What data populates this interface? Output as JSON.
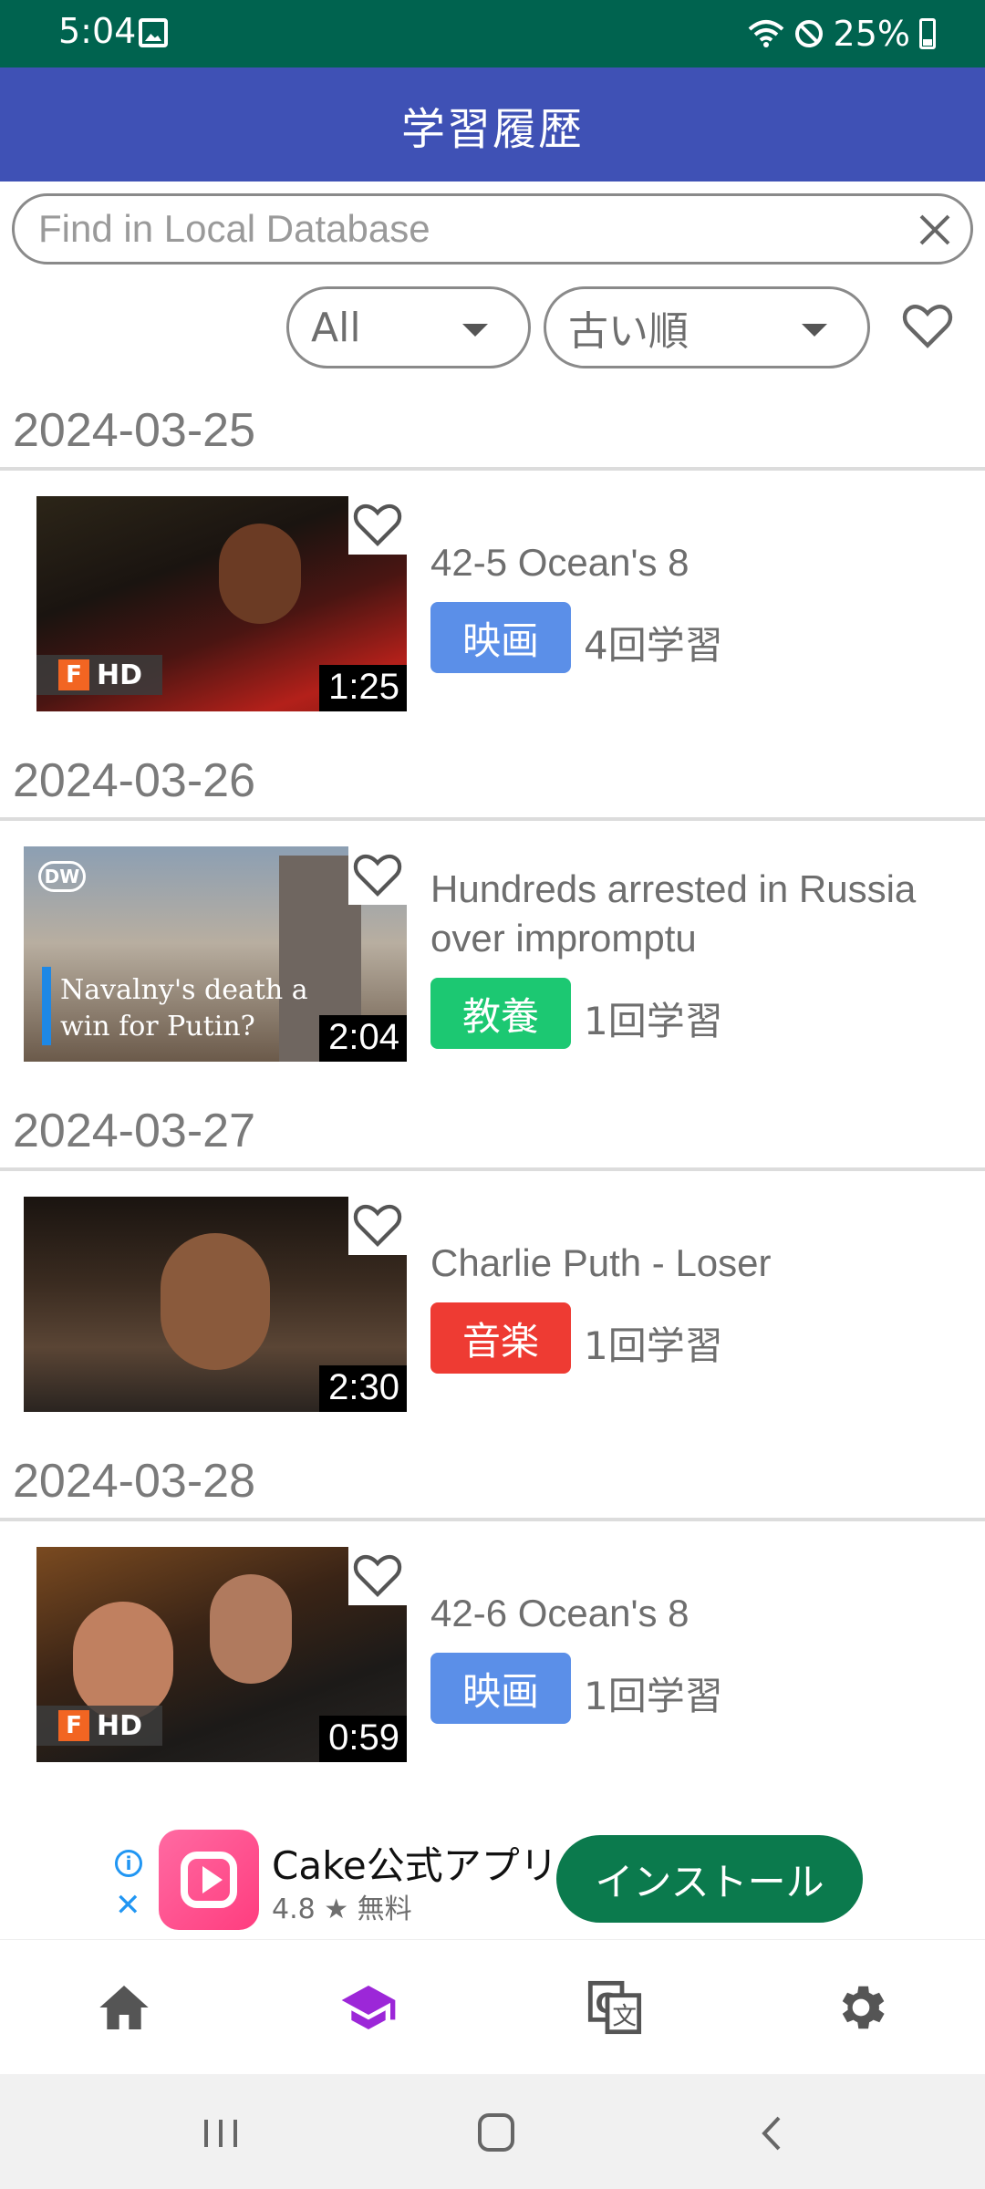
{
  "status_bar": {
    "time": "5:04",
    "battery": "25%"
  },
  "header": {
    "title": "学習履歴"
  },
  "search": {
    "placeholder": "Find in Local Database"
  },
  "filters": {
    "category": "All",
    "sort": "古い順"
  },
  "history": [
    {
      "date": "2024-03-25",
      "title": "42-5 Ocean's 8",
      "tag": "映画",
      "tag_color": "#5b8fe8",
      "count": "4回学習",
      "duration": "1:25",
      "hd_badge": "HD"
    },
    {
      "date": "2024-03-26",
      "title": "Hundreds arrested in Russia over impromptu",
      "tag": "教養",
      "tag_color": "#1cc872",
      "count": "1回学習",
      "duration": "2:04",
      "caption": "Navalny's death a win for Putin?"
    },
    {
      "date": "2024-03-27",
      "title": "Charlie Puth - Loser",
      "tag": "音楽",
      "tag_color": "#ee3b33",
      "count": "1回学習",
      "duration": "2:30"
    },
    {
      "date": "2024-03-28",
      "title": "42-6 Ocean's 8",
      "tag": "映画",
      "tag_color": "#5b8fe8",
      "count": "1回学習",
      "duration": "0:59",
      "hd_badge": "HD"
    }
  ],
  "ad": {
    "app_name": "Cake公式アプリ",
    "rating": "4.8 ★ 無料",
    "install_label": "インストール"
  },
  "bottom_nav": {
    "items": [
      "home-icon",
      "study-history-icon",
      "translate-icon",
      "settings-icon"
    ],
    "active_color": "#9c27d8"
  }
}
